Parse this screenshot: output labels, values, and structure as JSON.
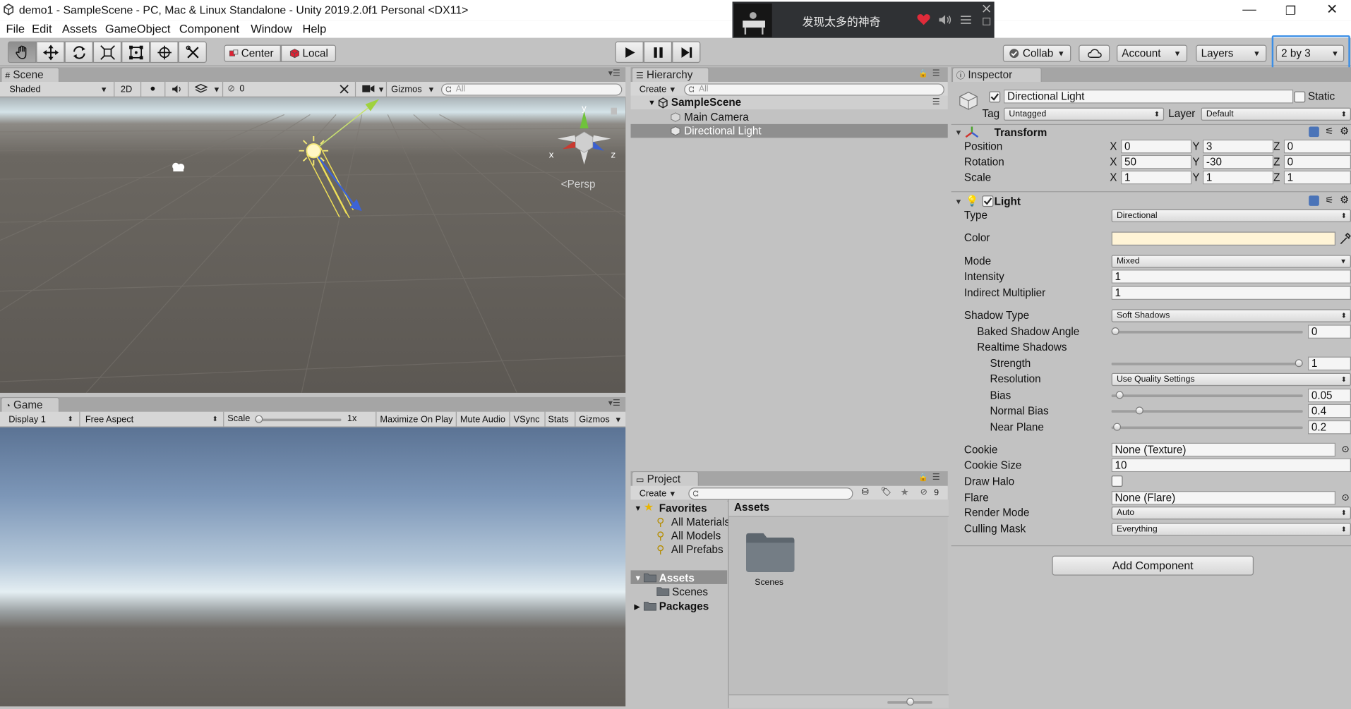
{
  "window": {
    "title": "demo1 - SampleScene - PC, Mac & Linux Standalone - Unity 2019.2.0f1 Personal <DX11>",
    "controls": {
      "minimize": "—",
      "maximize": "❐",
      "close": "✕"
    }
  },
  "menu": [
    "File",
    "Edit",
    "Assets",
    "GameObject",
    "Component",
    "Window",
    "Help"
  ],
  "music_player": {
    "song": "发现太多的神奇"
  },
  "toolbar": {
    "pivot": "Center",
    "space": "Local",
    "collab": "Collab",
    "account": "Account",
    "layers": "Layers",
    "layout": "2 by 3"
  },
  "scene": {
    "tab": "Scene",
    "shading": "Shaded",
    "mode_2d": "2D",
    "hidden_count": "0",
    "gizmos": "Gizmos",
    "search_placeholder": "All",
    "persp": "Persp",
    "axis_x": "x",
    "axis_y": "y",
    "axis_z": "z"
  },
  "game": {
    "tab": "Game",
    "display": "Display 1",
    "aspect": "Free Aspect",
    "scale_label": "Scale",
    "scale_value": 0,
    "scale_text": "1x",
    "maximize": "Maximize On Play",
    "mute": "Mute Audio",
    "vsync": "VSync",
    "stats": "Stats",
    "gizmos": "Gizmos"
  },
  "hierarchy": {
    "tab": "Hierarchy",
    "create": "Create",
    "search_placeholder": "All",
    "scene": "SampleScene",
    "objects": [
      "Main Camera",
      "Directional Light"
    ],
    "selected": "Directional Light"
  },
  "project": {
    "tab": "Project",
    "create": "Create",
    "hidden_count": "9",
    "favorites": "Favorites",
    "favorite_items": [
      "All Materials",
      "All Models",
      "All Prefabs"
    ],
    "assets_root": "Assets",
    "asset_children": [
      "Scenes"
    ],
    "packages": "Packages",
    "breadcrumb": "Assets",
    "grid_items": [
      "Scenes"
    ],
    "zoom": 0.5
  },
  "inspector": {
    "tab": "Inspector",
    "object_name": "Directional Light",
    "static_label": "Static",
    "tag_label": "Tag",
    "tag": "Untagged",
    "layer_label": "Layer",
    "layer": "Default",
    "transform": {
      "title": "Transform",
      "axes": [
        "X",
        "Y",
        "Z"
      ],
      "rows": [
        {
          "label": "Position",
          "values": [
            "0",
            "3",
            "0"
          ]
        },
        {
          "label": "Rotation",
          "values": [
            "50",
            "-30",
            "0"
          ]
        },
        {
          "label": "Scale",
          "values": [
            "1",
            "1",
            "1"
          ]
        }
      ]
    },
    "light": {
      "title": "Light",
      "type_label": "Type",
      "type": "Directional",
      "color_label": "Color",
      "color": "#fff4d6",
      "mode_label": "Mode",
      "mode": "Mixed",
      "intensity_label": "Intensity",
      "intensity": "1",
      "indirect_label": "Indirect Multiplier",
      "indirect": "1",
      "shadow_type_label": "Shadow Type",
      "shadow_type": "Soft Shadows",
      "baked_angle_label": "Baked Shadow Angle",
      "baked_angle": "0",
      "baked_angle_level": 0,
      "realtime_label": "Realtime Shadows",
      "strength_label": "Strength",
      "strength": "1",
      "strength_level": 1,
      "resolution_label": "Resolution",
      "resolution": "Use Quality Settings",
      "bias_label": "Bias",
      "bias": "0.05",
      "bias_level": 0.025,
      "normal_bias_label": "Normal Bias",
      "normal_bias": "0.4",
      "normal_bias_level": 0.13,
      "near_plane_label": "Near Plane",
      "near_plane": "0.2",
      "near_plane_level": 0.01,
      "cookie_label": "Cookie",
      "cookie": "None (Texture)",
      "cookie_size_label": "Cookie Size",
      "cookie_size": "10",
      "draw_halo_label": "Draw Halo",
      "flare_label": "Flare",
      "flare": "None (Flare)",
      "render_mode_label": "Render Mode",
      "render_mode": "Auto",
      "culling_label": "Culling Mask",
      "culling": "Everything"
    },
    "add_component": "Add Component"
  },
  "colors": {
    "selection_highlight": "#3a8ee6",
    "light_yellow": "#f0e058"
  }
}
